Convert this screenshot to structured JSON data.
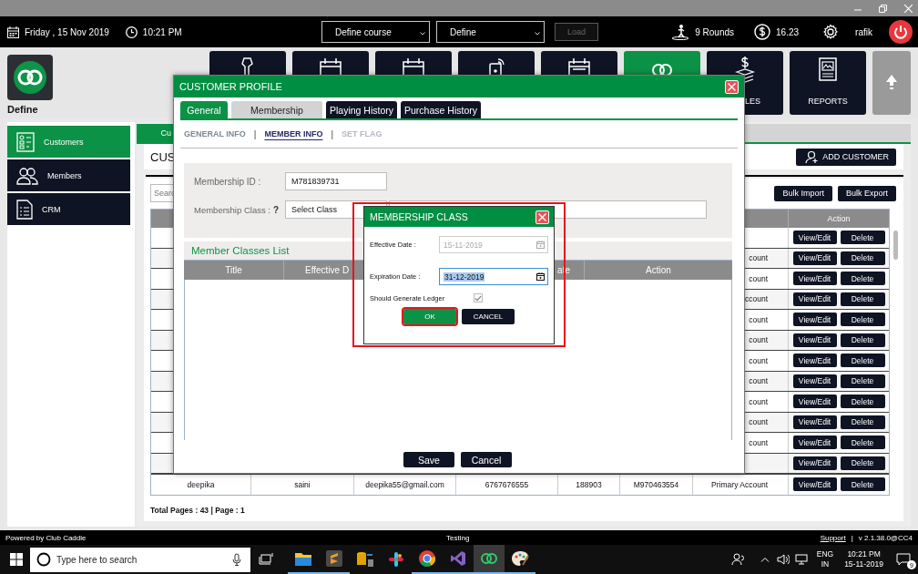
{
  "top_bar": {
    "date": "Friday , 15 Nov 2019",
    "time": "10:21 PM",
    "course_select": "Define course",
    "facility_select": "Define",
    "load_button": {
      "label": "Load",
      "disabled": true
    },
    "rounds": "9 Rounds",
    "balance": "16.23",
    "user": "rafik"
  },
  "brand": {
    "name": "Define"
  },
  "nav_tiles": [
    {
      "selected": false
    },
    {
      "selected": false
    },
    {
      "selected": false
    },
    {
      "selected": false
    },
    {
      "selected": false
    },
    {
      "selected": true
    },
    {
      "label": "LES",
      "selected": false
    },
    {
      "label": "REPORTS",
      "selected": false
    }
  ],
  "sidebar": {
    "items": [
      {
        "label": "Customers",
        "selected": true
      },
      {
        "label": "Members",
        "selected": false
      },
      {
        "label": "CRM",
        "selected": false
      }
    ]
  },
  "customers_page": {
    "tab": "Cu",
    "heading": "CUS",
    "add_button": "ADD CUSTOMER",
    "search": {
      "placeholder": "Searc"
    },
    "bulk_buttons": [
      "Bulk Import",
      "Bulk Export"
    ],
    "table": {
      "action_column": "Action",
      "rows": [
        {
          "actions": [
            "View/Edit",
            "Delete"
          ]
        },
        {
          "column_7": "count",
          "actions": [
            "View/Edit",
            "Delete"
          ]
        },
        {
          "column_7": "count",
          "actions": [
            "View/Edit",
            "Delete"
          ]
        },
        {
          "column_7": "ccount",
          "actions": [
            "View/Edit",
            "Delete"
          ]
        },
        {
          "column_7": "count",
          "actions": [
            "View/Edit",
            "Delete"
          ]
        },
        {
          "column_7": "count",
          "actions": [
            "View/Edit",
            "Delete"
          ]
        },
        {
          "column_7": "count",
          "actions": [
            "View/Edit",
            "Delete"
          ]
        },
        {
          "column_7": "count",
          "actions": [
            "View/Edit",
            "Delete"
          ]
        },
        {
          "column_7": "count",
          "actions": [
            "View/Edit",
            "Delete"
          ]
        },
        {
          "column_7": "count",
          "actions": [
            "View/Edit",
            "Delete"
          ]
        },
        {
          "column_7": "count",
          "actions": [
            "View/Edit",
            "Delete"
          ]
        },
        {
          "actions": [
            "View/Edit",
            "Delete"
          ]
        },
        {
          "column_1": "deepika",
          "column_2": "saini",
          "column_3": "deepika55@gmail.com",
          "column_4": "6767676555",
          "column_5": "188903",
          "column_6": "M970463554",
          "column_7": "Primary Account",
          "actions": [
            "View/Edit",
            "Delete"
          ]
        }
      ]
    },
    "footer": "Total Pages : 43 | Page : 1"
  },
  "customer_profile": {
    "title": "CUSTOMER PROFILE",
    "tabs": [
      {
        "label": "General",
        "selected": true,
        "hovered": false
      },
      {
        "label": "Membership",
        "selected": false,
        "hovered": true
      },
      {
        "label": "Playing History",
        "selected": false,
        "hovered": false
      },
      {
        "label": "Purchase History",
        "selected": false,
        "hovered": false
      }
    ],
    "sections": [
      {
        "label": "GENERAL INFO",
        "selected": false,
        "disabled": false
      },
      {
        "label": "MEMBER INFO",
        "selected": true,
        "disabled": false
      },
      {
        "label": "SET FLAG",
        "selected": false,
        "disabled": true
      }
    ],
    "section_separators": [
      "|",
      "|"
    ],
    "membership_id": {
      "label": "Membership ID :",
      "value": "M781839731"
    },
    "membership_class": {
      "label": "Membership Class :",
      "help": "?",
      "value": "Select Class"
    },
    "classes_list": {
      "title": "Member Classes List",
      "columns": [
        "Title",
        "Effective D",
        "ate",
        "Action"
      ]
    },
    "buttons": [
      "Save",
      "Cancel"
    ]
  },
  "membership_class_dialog": {
    "title": "MEMBERSHIP CLASS",
    "effective_date": {
      "label": "Effective Date :",
      "value": "15-11-2019",
      "disabled": true
    },
    "expiration_date": {
      "label": "Expiration Date :",
      "value": "31-12-2019",
      "disabled": false
    },
    "ledger": {
      "label": "Should Generate Ledger",
      "checked": true,
      "disabled": true
    },
    "buttons": [
      {
        "label": "OK",
        "focused": true
      },
      {
        "label": "CANCEL",
        "focused": false
      }
    ]
  },
  "status_bar": {
    "left": "Powered by Club Caddie",
    "center": "Testing",
    "support_link": "Support",
    "separator": "|",
    "version": "v 2.1.38.0@CC4"
  },
  "taskbar": {
    "search_placeholder": "Type here to search",
    "apps": [
      {
        "running": true,
        "active": false
      },
      {
        "running": true,
        "active": false
      },
      {
        "running": false,
        "active": false
      },
      {
        "running": false,
        "active": false
      },
      {
        "running": true,
        "active": false
      },
      {
        "running": true,
        "active": false
      },
      {
        "running": true,
        "active": true
      },
      {
        "running": true,
        "active": false
      }
    ],
    "language": "ENG",
    "region": "IN",
    "time": "10:21 PM",
    "date": "15-11-2019",
    "notification_count": "9"
  }
}
